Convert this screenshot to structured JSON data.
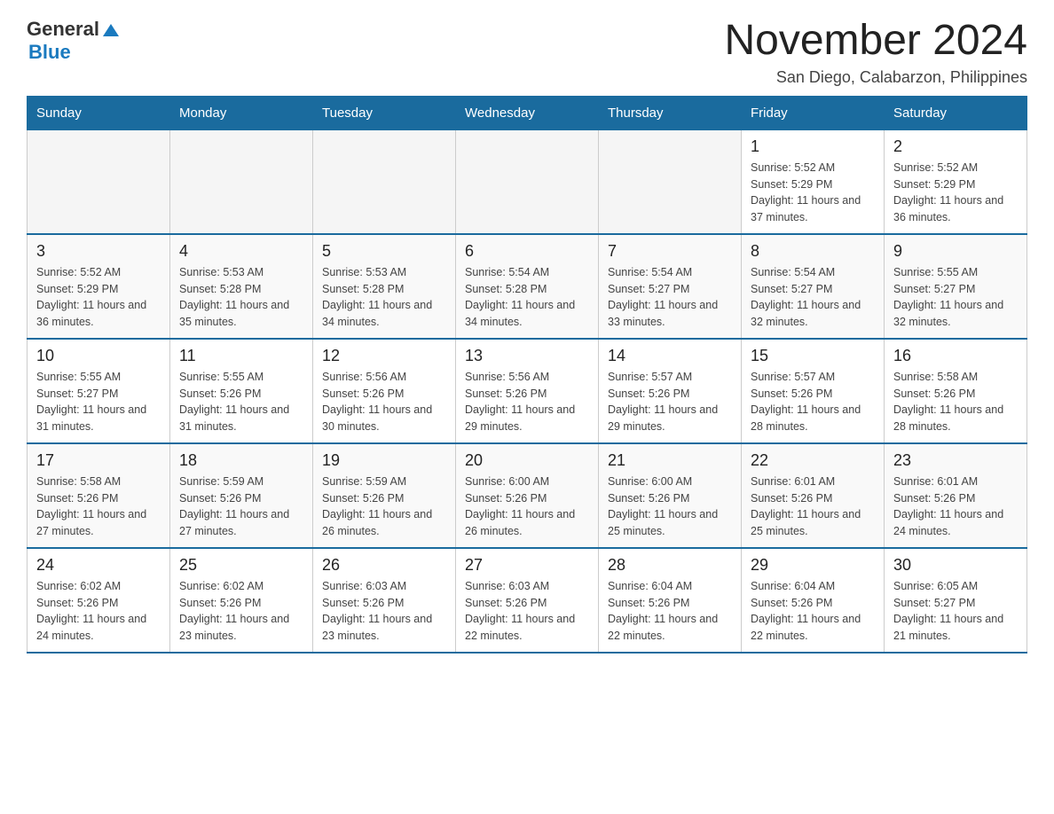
{
  "header": {
    "logo_general": "General",
    "logo_blue": "Blue",
    "month_title": "November 2024",
    "location": "San Diego, Calabarzon, Philippines"
  },
  "days_of_week": [
    "Sunday",
    "Monday",
    "Tuesday",
    "Wednesday",
    "Thursday",
    "Friday",
    "Saturday"
  ],
  "weeks": [
    [
      {
        "day": "",
        "info": ""
      },
      {
        "day": "",
        "info": ""
      },
      {
        "day": "",
        "info": ""
      },
      {
        "day": "",
        "info": ""
      },
      {
        "day": "",
        "info": ""
      },
      {
        "day": "1",
        "info": "Sunrise: 5:52 AM\nSunset: 5:29 PM\nDaylight: 11 hours and 37 minutes."
      },
      {
        "day": "2",
        "info": "Sunrise: 5:52 AM\nSunset: 5:29 PM\nDaylight: 11 hours and 36 minutes."
      }
    ],
    [
      {
        "day": "3",
        "info": "Sunrise: 5:52 AM\nSunset: 5:29 PM\nDaylight: 11 hours and 36 minutes."
      },
      {
        "day": "4",
        "info": "Sunrise: 5:53 AM\nSunset: 5:28 PM\nDaylight: 11 hours and 35 minutes."
      },
      {
        "day": "5",
        "info": "Sunrise: 5:53 AM\nSunset: 5:28 PM\nDaylight: 11 hours and 34 minutes."
      },
      {
        "day": "6",
        "info": "Sunrise: 5:54 AM\nSunset: 5:28 PM\nDaylight: 11 hours and 34 minutes."
      },
      {
        "day": "7",
        "info": "Sunrise: 5:54 AM\nSunset: 5:27 PM\nDaylight: 11 hours and 33 minutes."
      },
      {
        "day": "8",
        "info": "Sunrise: 5:54 AM\nSunset: 5:27 PM\nDaylight: 11 hours and 32 minutes."
      },
      {
        "day": "9",
        "info": "Sunrise: 5:55 AM\nSunset: 5:27 PM\nDaylight: 11 hours and 32 minutes."
      }
    ],
    [
      {
        "day": "10",
        "info": "Sunrise: 5:55 AM\nSunset: 5:27 PM\nDaylight: 11 hours and 31 minutes."
      },
      {
        "day": "11",
        "info": "Sunrise: 5:55 AM\nSunset: 5:26 PM\nDaylight: 11 hours and 31 minutes."
      },
      {
        "day": "12",
        "info": "Sunrise: 5:56 AM\nSunset: 5:26 PM\nDaylight: 11 hours and 30 minutes."
      },
      {
        "day": "13",
        "info": "Sunrise: 5:56 AM\nSunset: 5:26 PM\nDaylight: 11 hours and 29 minutes."
      },
      {
        "day": "14",
        "info": "Sunrise: 5:57 AM\nSunset: 5:26 PM\nDaylight: 11 hours and 29 minutes."
      },
      {
        "day": "15",
        "info": "Sunrise: 5:57 AM\nSunset: 5:26 PM\nDaylight: 11 hours and 28 minutes."
      },
      {
        "day": "16",
        "info": "Sunrise: 5:58 AM\nSunset: 5:26 PM\nDaylight: 11 hours and 28 minutes."
      }
    ],
    [
      {
        "day": "17",
        "info": "Sunrise: 5:58 AM\nSunset: 5:26 PM\nDaylight: 11 hours and 27 minutes."
      },
      {
        "day": "18",
        "info": "Sunrise: 5:59 AM\nSunset: 5:26 PM\nDaylight: 11 hours and 27 minutes."
      },
      {
        "day": "19",
        "info": "Sunrise: 5:59 AM\nSunset: 5:26 PM\nDaylight: 11 hours and 26 minutes."
      },
      {
        "day": "20",
        "info": "Sunrise: 6:00 AM\nSunset: 5:26 PM\nDaylight: 11 hours and 26 minutes."
      },
      {
        "day": "21",
        "info": "Sunrise: 6:00 AM\nSunset: 5:26 PM\nDaylight: 11 hours and 25 minutes."
      },
      {
        "day": "22",
        "info": "Sunrise: 6:01 AM\nSunset: 5:26 PM\nDaylight: 11 hours and 25 minutes."
      },
      {
        "day": "23",
        "info": "Sunrise: 6:01 AM\nSunset: 5:26 PM\nDaylight: 11 hours and 24 minutes."
      }
    ],
    [
      {
        "day": "24",
        "info": "Sunrise: 6:02 AM\nSunset: 5:26 PM\nDaylight: 11 hours and 24 minutes."
      },
      {
        "day": "25",
        "info": "Sunrise: 6:02 AM\nSunset: 5:26 PM\nDaylight: 11 hours and 23 minutes."
      },
      {
        "day": "26",
        "info": "Sunrise: 6:03 AM\nSunset: 5:26 PM\nDaylight: 11 hours and 23 minutes."
      },
      {
        "day": "27",
        "info": "Sunrise: 6:03 AM\nSunset: 5:26 PM\nDaylight: 11 hours and 22 minutes."
      },
      {
        "day": "28",
        "info": "Sunrise: 6:04 AM\nSunset: 5:26 PM\nDaylight: 11 hours and 22 minutes."
      },
      {
        "day": "29",
        "info": "Sunrise: 6:04 AM\nSunset: 5:26 PM\nDaylight: 11 hours and 22 minutes."
      },
      {
        "day": "30",
        "info": "Sunrise: 6:05 AM\nSunset: 5:27 PM\nDaylight: 11 hours and 21 minutes."
      }
    ]
  ]
}
